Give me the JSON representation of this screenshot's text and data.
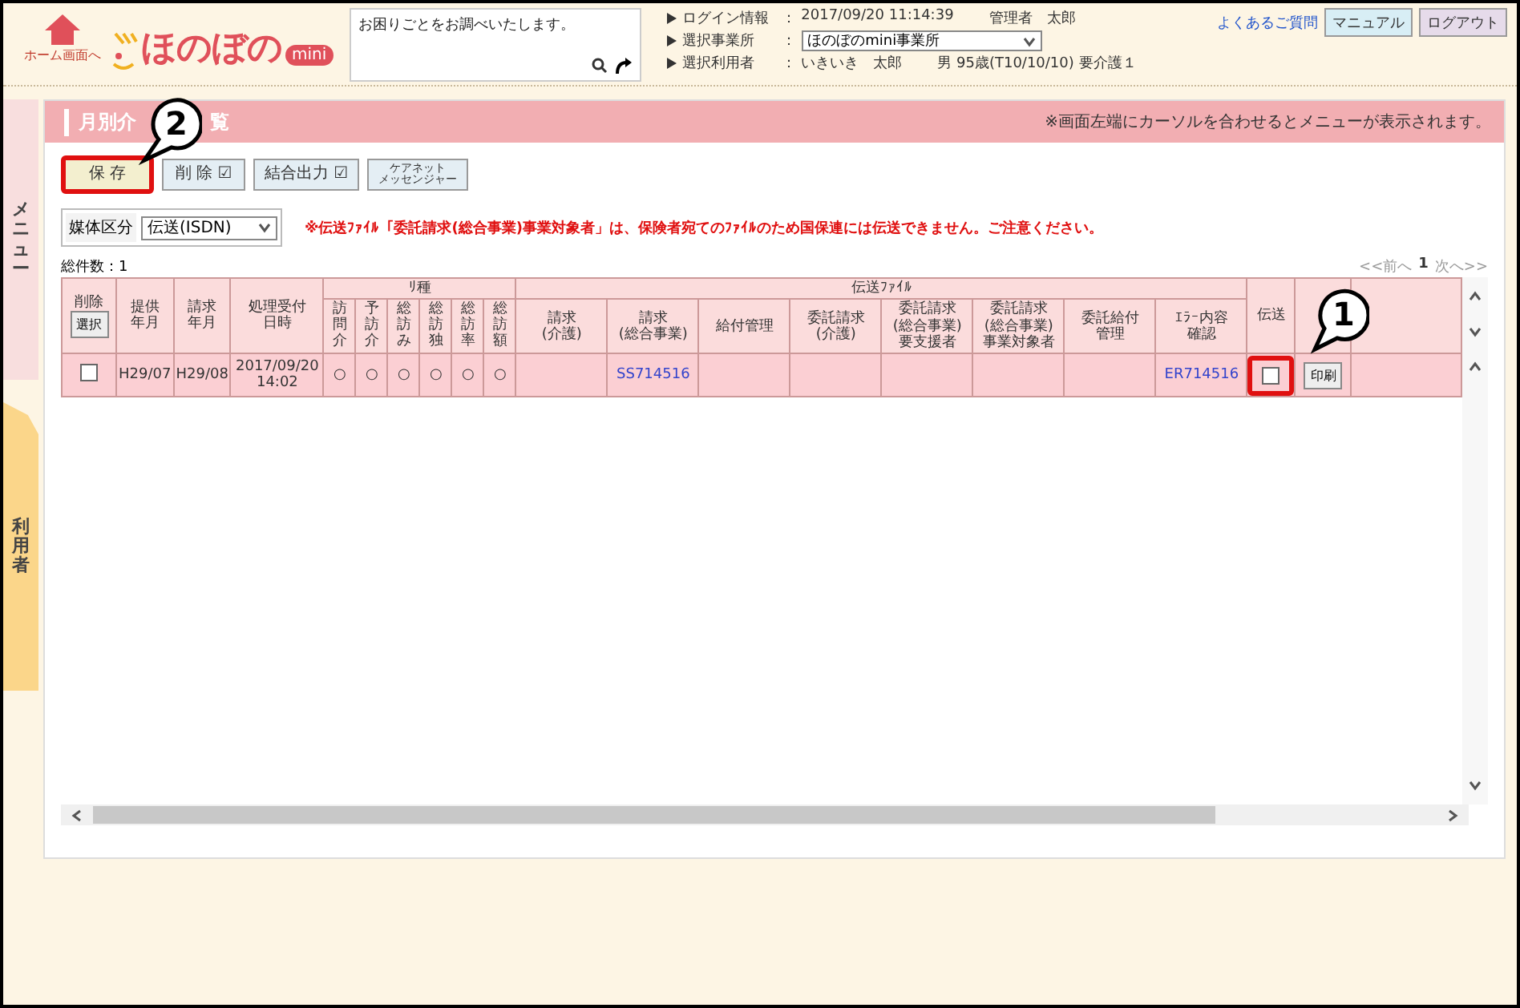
{
  "header": {
    "home_label": "ホーム画面へ",
    "logo_text": "ほのぼの",
    "logo_badge": "mini",
    "search": {
      "placeholder": "お困りごとをお調べいたします。"
    },
    "info": [
      {
        "label": "ログイン情報",
        "separator": "：",
        "kind": "text",
        "values": [
          "2017/09/20 11:14:39",
          "管理者　太郎"
        ]
      },
      {
        "label": "選択事業所",
        "separator": "：",
        "kind": "select",
        "values": [
          "ほのぼのmini事業所"
        ]
      },
      {
        "label": "選択利用者",
        "separator": "：",
        "kind": "text",
        "values": [
          "いきいき　太郎",
          "男 95歳(T10/10/10) 要介護１"
        ]
      }
    ],
    "faq_link": "よくあるご質問",
    "buttons": [
      {
        "label": "マニュアル",
        "kind": "manual"
      },
      {
        "label": "ログアウト",
        "kind": "logout"
      }
    ]
  },
  "side_tabs": [
    {
      "label": "メニュー",
      "kind": "menu"
    },
    {
      "label": "利用者",
      "kind": "user"
    }
  ],
  "panel": {
    "title_start": "月別介",
    "title_end": "覧",
    "notice": "※画面左端にカーソルを合わせるとメニューが表示されます。",
    "toolbar": [
      {
        "lines": [
          "保 存"
        ],
        "highlighted": true
      },
      {
        "lines": [
          "削 除"
        ],
        "mark": "☑",
        "highlighted": false
      },
      {
        "lines": [
          "結合出力"
        ],
        "mark": "☑",
        "highlighted": false
      },
      {
        "lines": [
          "ケアネット",
          "メッセンジャー"
        ],
        "highlighted": false
      }
    ],
    "media": {
      "label": "媒体区分",
      "value": "伝送(ISDN)"
    },
    "warning": "※伝送ﾌｧｲﾙ「委託請求(総合事業)事業対象者」は、保険者宛てのﾌｧｲﾙのため国保連には伝送できません。ご注意ください。",
    "total": "総件数：1",
    "pager": {
      "prev": "<<前へ",
      "page": "1",
      "next": "次へ>>"
    },
    "table": {
      "delete_header": "削除",
      "select_button": "選択",
      "columns": [
        "提供年月",
        "請求年月",
        "処理受付日時"
      ],
      "group_a": "ﾘ種",
      "narrow_columns": [
        "訪問介",
        "予訪介",
        "総訪み",
        "総訪独",
        "総訪率",
        "総訪額"
      ],
      "group_b": "伝送ﾌｧｲﾙ",
      "file_columns": [
        "請求\n(介護)",
        "請求\n(総合事業)",
        "給付管理",
        "委託請求\n(介護)",
        "委託請求\n(総合事業)\n要支援者",
        "委託請求\n(総合事業)\n事業対象者",
        "委託給付管理",
        "ｴﾗｰ内容確認"
      ],
      "send_header": "伝送",
      "rows": [
        {
          "delete_checked": false,
          "cells": [
            "H29/07",
            "H29/08",
            "2017/09/20\n14:02"
          ],
          "marks": [
            "○",
            "○",
            "○",
            "○",
            "○",
            "○"
          ],
          "files": [
            {
              "kind": "empty"
            },
            {
              "kind": "link",
              "text": "SS714516"
            },
            {
              "kind": "empty"
            },
            {
              "kind": "empty"
            },
            {
              "kind": "empty"
            },
            {
              "kind": "empty"
            },
            {
              "kind": "empty"
            },
            {
              "kind": "link",
              "text": "ER714516"
            }
          ],
          "send_checked": false,
          "send_highlighted": true,
          "print_label": "印刷"
        }
      ]
    }
  },
  "callouts": [
    {
      "number": "2"
    },
    {
      "number": "1"
    }
  ]
}
